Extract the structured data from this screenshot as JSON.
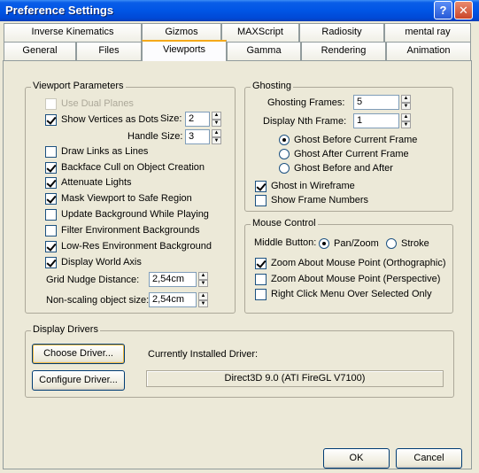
{
  "window": {
    "title": "Preference Settings",
    "help_glyph": "?",
    "close_glyph": "✕"
  },
  "tabs_row1": [
    "Inverse Kinematics",
    "Gizmos",
    "MAXScript",
    "Radiosity",
    "mental ray"
  ],
  "tabs_row2": [
    "General",
    "Files",
    "Viewports",
    "Gamma",
    "Rendering",
    "Animation"
  ],
  "active_tab": "Viewports",
  "viewport_params": {
    "title": "Viewport Parameters",
    "use_dual_planes": "Use Dual Planes",
    "show_vertices": "Show Vertices as Dots",
    "size_label": "Size:",
    "size_value": "2",
    "handle_size_label": "Handle Size:",
    "handle_size_value": "3",
    "draw_links": "Draw Links as Lines",
    "backface_cull": "Backface Cull on Object Creation",
    "attenuate_lights": "Attenuate Lights",
    "mask_viewport": "Mask Viewport to Safe Region",
    "update_background": "Update Background While Playing",
    "filter_env": "Filter Environment Backgrounds",
    "lowres_env": "Low-Res Environment Background",
    "display_world_axis": "Display World Axis",
    "grid_nudge_label": "Grid Nudge Distance:",
    "grid_nudge_value": "2,54cm",
    "nonscaling_label": "Non-scaling object size:",
    "nonscaling_value": "2,54cm"
  },
  "ghosting": {
    "title": "Ghosting",
    "frames_label": "Ghosting Frames:",
    "frames_value": "5",
    "nth_label": "Display Nth Frame:",
    "nth_value": "1",
    "before": "Ghost Before Current Frame",
    "after": "Ghost After Current Frame",
    "before_after": "Ghost Before and After",
    "wireframe": "Ghost in Wireframe",
    "show_frame_numbers": "Show Frame Numbers"
  },
  "mouse_control": {
    "title": "Mouse Control",
    "middle_button_label": "Middle Button:",
    "pan_zoom": "Pan/Zoom",
    "stroke": "Stroke",
    "zoom_ortho": "Zoom About Mouse Point (Orthographic)",
    "zoom_persp": "Zoom About Mouse Point (Perspective)",
    "right_click_menu": "Right Click Menu Over Selected Only"
  },
  "display_drivers": {
    "title": "Display Drivers",
    "choose_driver": "Choose Driver...",
    "configure_driver": "Configure Driver...",
    "installed_label": "Currently Installed Driver:",
    "installed_value": "Direct3D 9.0 (ATI FireGL V7100)"
  },
  "footer": {
    "ok": "OK",
    "cancel": "Cancel"
  },
  "arrows": {
    "up": "▲",
    "down": "▼"
  }
}
